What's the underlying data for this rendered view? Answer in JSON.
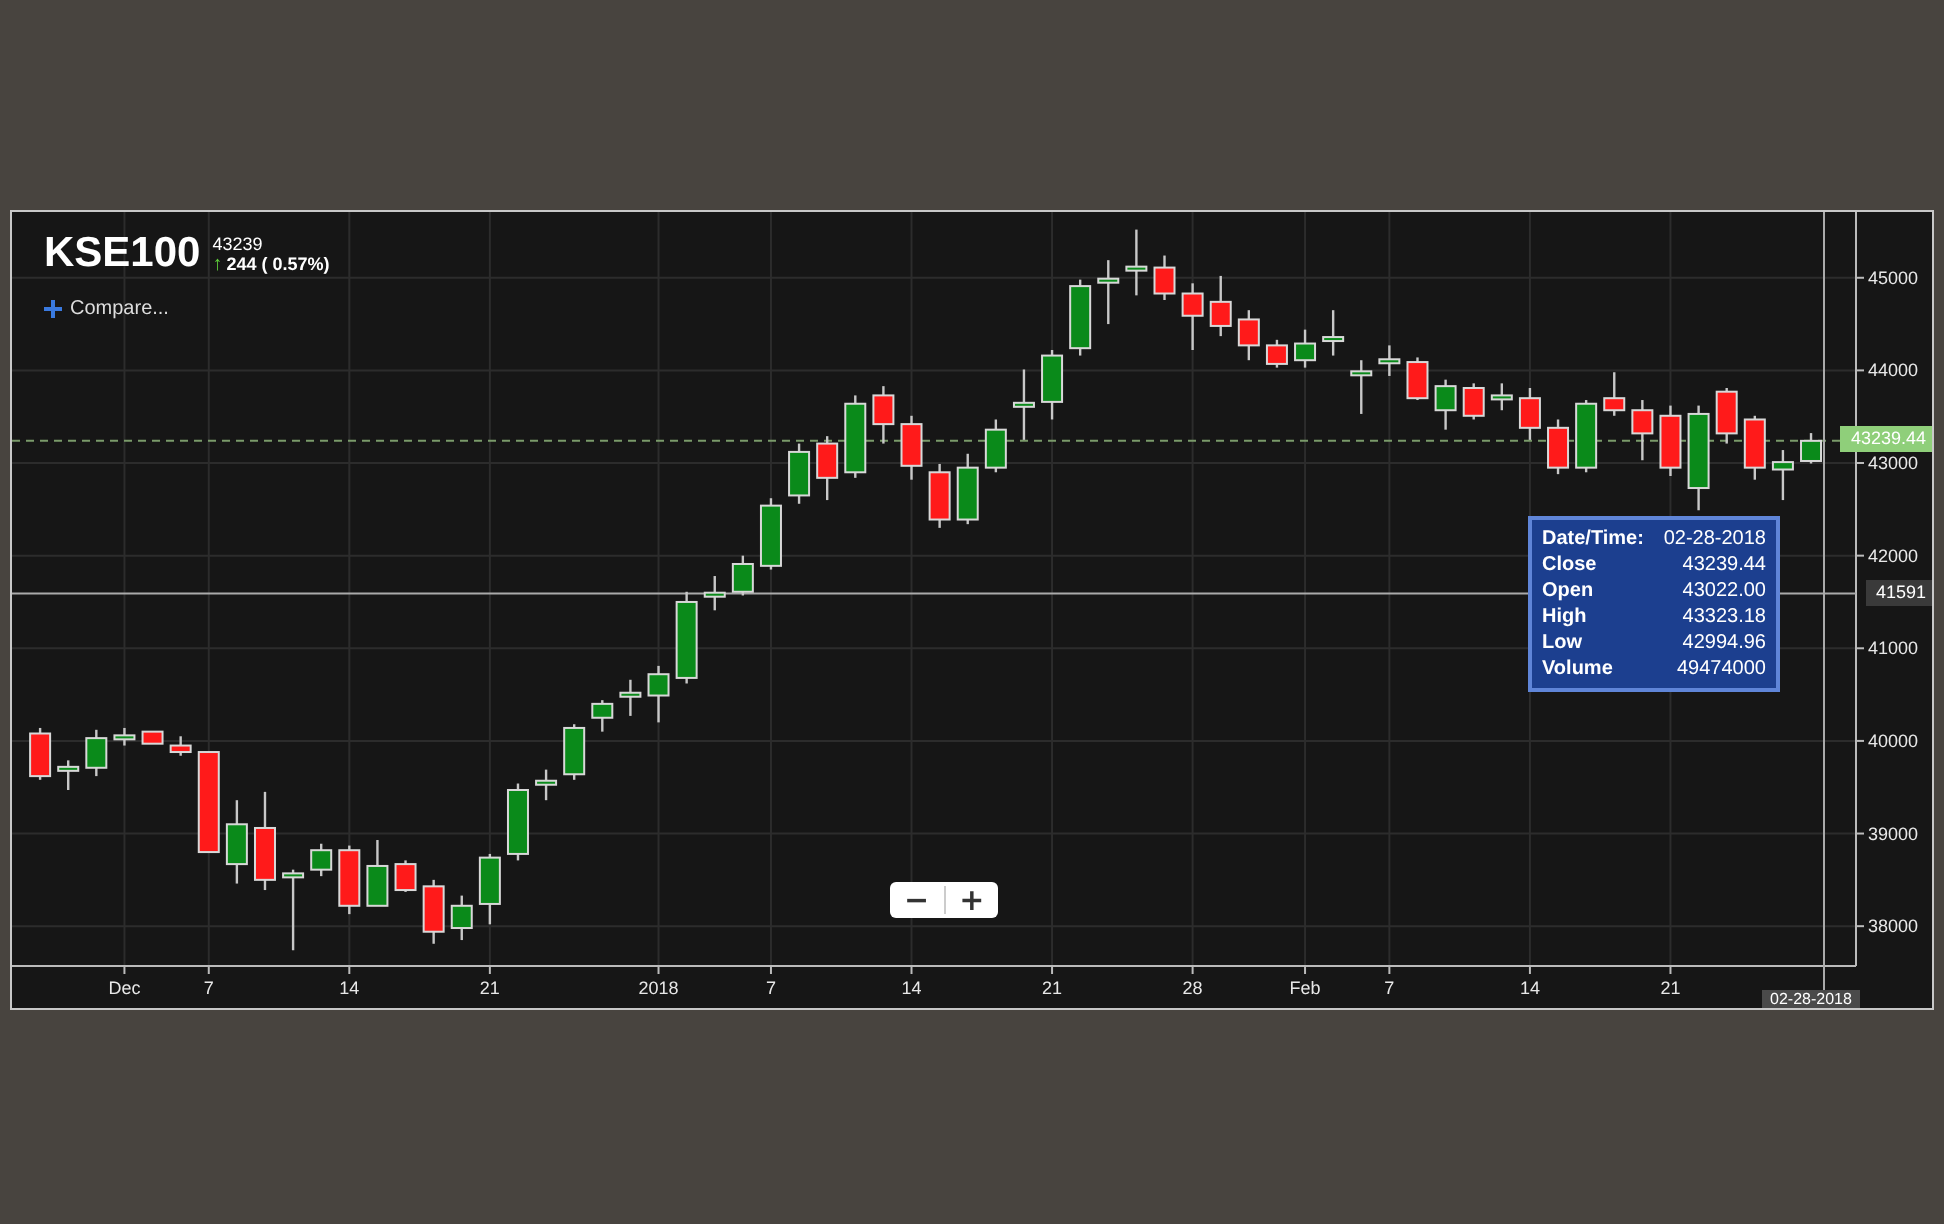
{
  "header": {
    "symbol": "KSE100",
    "price": "43239",
    "arrow": "↑",
    "change": "244 ( 0.57%)"
  },
  "compare": {
    "label": "Compare..."
  },
  "chart": {
    "chart_data": {
      "type": "candlestick",
      "categories": [
        null,
        null,
        null,
        "Dec",
        null,
        null,
        "7",
        null,
        null,
        null,
        null,
        "14",
        null,
        null,
        null,
        null,
        "21",
        null,
        null,
        null,
        null,
        null,
        "2018",
        null,
        null,
        null,
        "7",
        null,
        null,
        null,
        null,
        "14",
        null,
        null,
        null,
        null,
        "21",
        null,
        null,
        null,
        null,
        "28",
        null,
        null,
        null,
        "Feb",
        null,
        null,
        "7",
        null,
        null,
        null,
        null,
        "14",
        null,
        null,
        null,
        null,
        "21",
        null,
        null,
        null,
        null,
        null
      ],
      "ohlc": [
        [
          40080,
          40140,
          39580,
          39620
        ],
        [
          39690,
          39790,
          39470,
          39720
        ],
        [
          39710,
          40120,
          39620,
          40030
        ],
        [
          40030,
          40140,
          39950,
          40060
        ],
        [
          40100,
          40100,
          39970,
          39970
        ],
        [
          39950,
          40050,
          39840,
          39880
        ],
        [
          39880,
          39880,
          38800,
          38800
        ],
        [
          38670,
          39360,
          38460,
          39100
        ],
        [
          39060,
          39450,
          38390,
          38500
        ],
        [
          38540,
          38610,
          37740,
          38570
        ],
        [
          38610,
          38890,
          38540,
          38820
        ],
        [
          38820,
          38870,
          38130,
          38220
        ],
        [
          38220,
          38930,
          38220,
          38650
        ],
        [
          38670,
          38710,
          38370,
          38390
        ],
        [
          38430,
          38500,
          37810,
          37940
        ],
        [
          37980,
          38330,
          37850,
          38220
        ],
        [
          38240,
          38780,
          38020,
          38740
        ],
        [
          38780,
          39540,
          38710,
          39470
        ],
        [
          39540,
          39690,
          39360,
          39570
        ],
        [
          39640,
          40180,
          39580,
          40140
        ],
        [
          40250,
          40440,
          40100,
          40400
        ],
        [
          40490,
          40660,
          40270,
          40520
        ],
        [
          40490,
          40810,
          40200,
          40720
        ],
        [
          40680,
          41610,
          40620,
          41500
        ],
        [
          41570,
          41780,
          41410,
          41600
        ],
        [
          41610,
          42000,
          41570,
          41910
        ],
        [
          41890,
          42620,
          41850,
          42540
        ],
        [
          42650,
          43210,
          42560,
          43120
        ],
        [
          43210,
          43290,
          42600,
          42840
        ],
        [
          42900,
          43730,
          42840,
          43640
        ],
        [
          43730,
          43830,
          43210,
          43420
        ],
        [
          43420,
          43510,
          42820,
          42970
        ],
        [
          42900,
          42990,
          42300,
          42390
        ],
        [
          42390,
          43100,
          42340,
          42950
        ],
        [
          42950,
          43470,
          42900,
          43360
        ],
        [
          43620,
          44010,
          43250,
          43650
        ],
        [
          43660,
          44220,
          43470,
          44160
        ],
        [
          44240,
          44980,
          44160,
          44910
        ],
        [
          44960,
          45190,
          44500,
          44990
        ],
        [
          45090,
          45520,
          44810,
          45120
        ],
        [
          45110,
          45240,
          44760,
          44830
        ],
        [
          44830,
          44940,
          44220,
          44590
        ],
        [
          44740,
          45020,
          44370,
          44480
        ],
        [
          44550,
          44650,
          44110,
          44270
        ],
        [
          44270,
          44330,
          44030,
          44070
        ],
        [
          44110,
          44440,
          44030,
          44290
        ],
        [
          44330,
          44650,
          44160,
          44360
        ],
        [
          43960,
          44110,
          43530,
          43990
        ],
        [
          44090,
          44270,
          43940,
          44120
        ],
        [
          44090,
          44140,
          43680,
          43700
        ],
        [
          43570,
          43900,
          43360,
          43830
        ],
        [
          43810,
          43860,
          43470,
          43510
        ],
        [
          43700,
          43860,
          43570,
          43730
        ],
        [
          43700,
          43810,
          43250,
          43380
        ],
        [
          43380,
          43470,
          42880,
          42950
        ],
        [
          42950,
          43680,
          42900,
          43640
        ],
        [
          43700,
          43980,
          43510,
          43570
        ],
        [
          43570,
          43680,
          43030,
          43320
        ],
        [
          43510,
          43620,
          42860,
          42950
        ],
        [
          42730,
          43620,
          42490,
          43530
        ],
        [
          43770,
          43810,
          43210,
          43320
        ],
        [
          43470,
          43510,
          42820,
          42950
        ],
        [
          42930,
          43140,
          42600,
          43010
        ],
        [
          43022,
          43323.18,
          42994.96,
          43239.44
        ]
      ],
      "ylim": [
        37570,
        45710
      ],
      "grid": true,
      "ref_lines": [
        {
          "axis": "y",
          "value": 43239.44,
          "label": "43239.44",
          "color": "#7a9a6a"
        },
        {
          "axis": "y",
          "value": 41591,
          "label": "41591",
          "color": "#aaaaaa"
        }
      ],
      "yticks": [
        45000,
        44000,
        43000,
        42000,
        41000,
        40000,
        39000,
        38000
      ]
    },
    "crosshair_date_label": "02-28-2018"
  },
  "tooltip": {
    "rows": [
      {
        "label": "Date/Time:",
        "value": "02-28-2018"
      },
      {
        "label": "Close",
        "value": "43239.44"
      },
      {
        "label": "Open",
        "value": "43022.00"
      },
      {
        "label": "High",
        "value": "43323.18"
      },
      {
        "label": "Low",
        "value": "42994.96"
      },
      {
        "label": "Volume",
        "value": "49474000"
      }
    ]
  },
  "zoom_controls": [
    {
      "label": "−"
    },
    {
      "label": "+"
    }
  ]
}
